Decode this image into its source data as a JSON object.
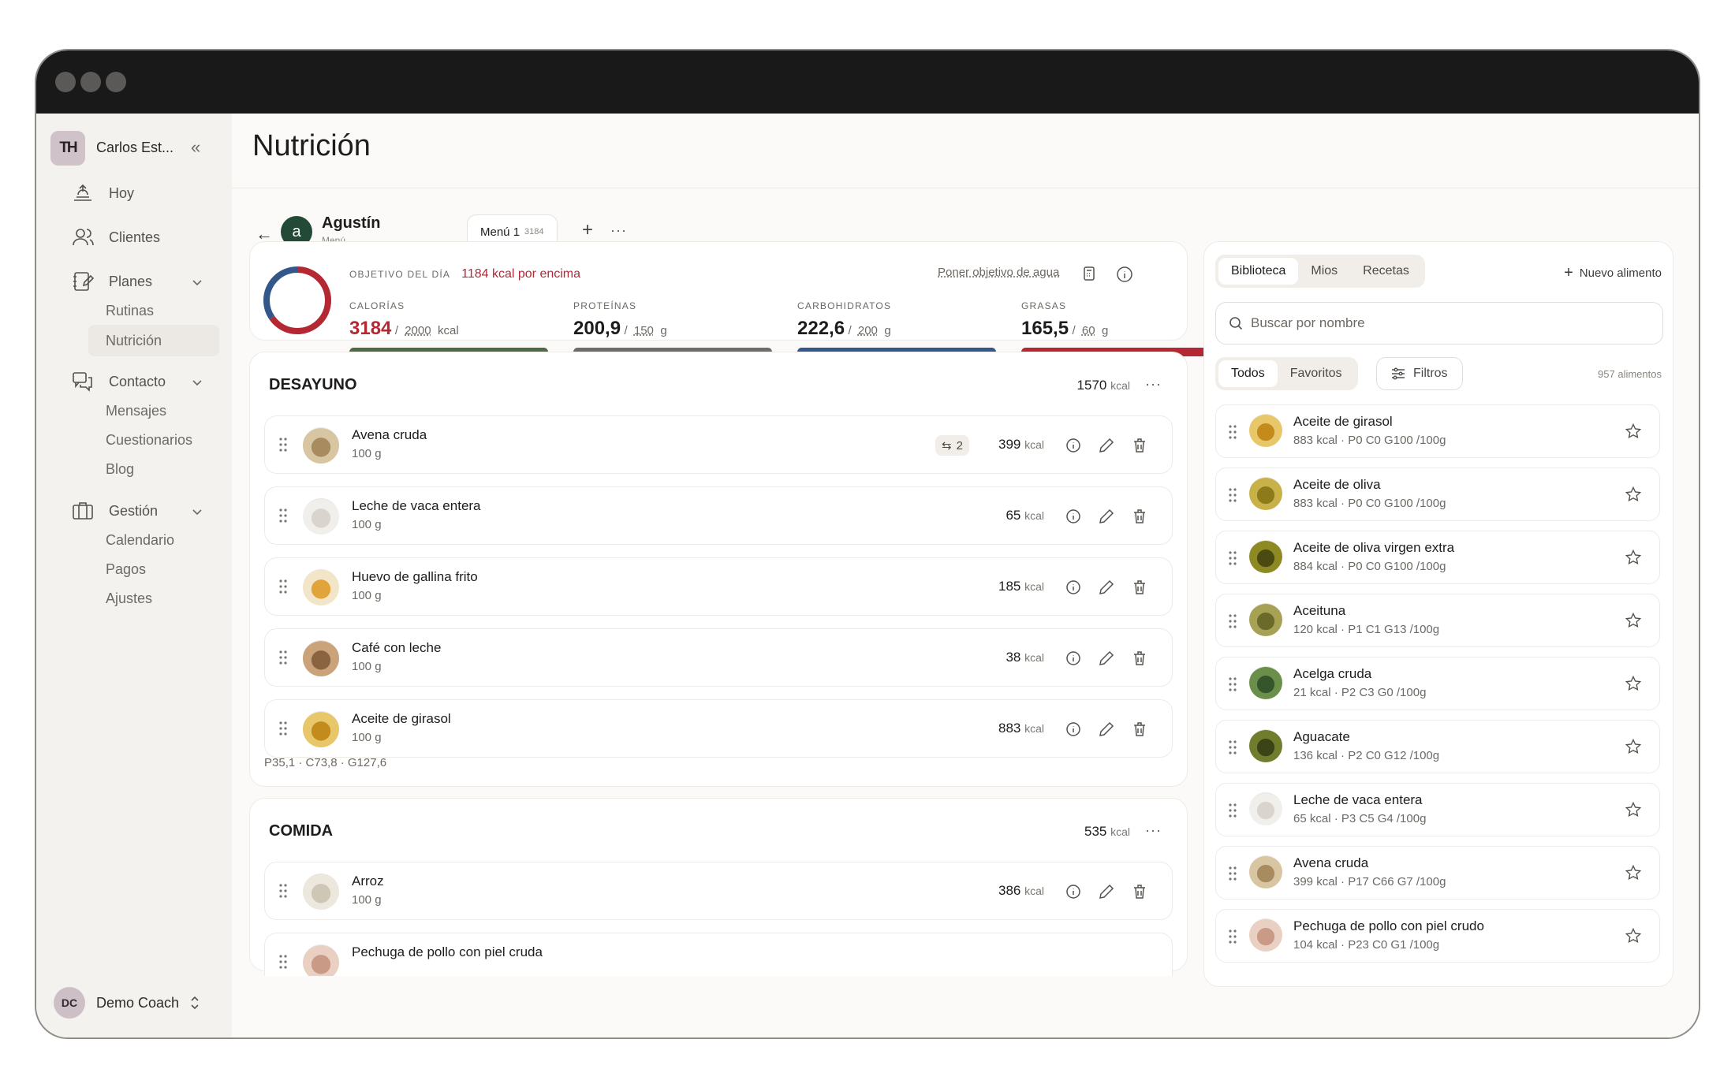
{
  "workspace": {
    "name": "Carlos Est...",
    "logo": "TH"
  },
  "nav": {
    "hoy": "Hoy",
    "clientes": "Clientes",
    "planes": "Planes",
    "rutinas": "Rutinas",
    "nutricion": "Nutrición",
    "contacto": "Contacto",
    "mensajes": "Mensajes",
    "cuestionarios": "Cuestionarios",
    "blog": "Blog",
    "gestion": "Gestión",
    "calendario": "Calendario",
    "pagos": "Pagos",
    "ajustes": "Ajustes"
  },
  "user": {
    "initials": "DC",
    "name": "Demo Coach"
  },
  "page": {
    "title": "Nutrición"
  },
  "client": {
    "initial": "a",
    "name": "Agustín",
    "sub": "Menú"
  },
  "menu": {
    "label": "Menú 1",
    "kcal": "3184"
  },
  "goal": {
    "label": "Objetivo del día",
    "status": "1184 kcal por encima",
    "water_link": "Poner objetivo de agua",
    "macros": [
      {
        "label": "Calorías",
        "value": "3184",
        "target": "2000",
        "unit": "kcal",
        "color": "#4e6a45",
        "fill": 1.0
      },
      {
        "label": "Proteínas",
        "value": "200,9",
        "target": "150",
        "unit": "g",
        "color": "#6e6a6d",
        "fill": 1.0
      },
      {
        "label": "Carbohidratos",
        "value": "222,6",
        "target": "200",
        "unit": "g",
        "color": "#33578a",
        "fill": 1.0
      },
      {
        "label": "Grasas",
        "value": "165,5",
        "target": "60",
        "unit": "g",
        "color": "#b42834",
        "fill": 1.0
      }
    ]
  },
  "meals": [
    {
      "title": "DESAYUNO",
      "kcal": "1570",
      "kcal_unit": "kcal",
      "summary": "P35,1 · C73,8 · G127,6",
      "items": [
        {
          "name": "Avena cruda",
          "qty": "100 g",
          "kcal": "399",
          "badge": "2"
        },
        {
          "name": "Leche de vaca entera",
          "qty": "100 g",
          "kcal": "65"
        },
        {
          "name": "Huevo de gallina frito",
          "qty": "100 g",
          "kcal": "185"
        },
        {
          "name": "Café con leche",
          "qty": "100 g",
          "kcal": "38"
        },
        {
          "name": "Aceite de girasol",
          "qty": "100 g",
          "kcal": "883"
        }
      ]
    },
    {
      "title": "COMIDA",
      "kcal": "535",
      "kcal_unit": "kcal",
      "items": [
        {
          "name": "Arroz",
          "qty": "100 g",
          "kcal": "386"
        },
        {
          "name": "Pechuga de pollo con piel cruda"
        }
      ]
    }
  ],
  "library": {
    "tabs": [
      "Biblioteca",
      "Mios",
      "Recetas"
    ],
    "new_food": "Nuevo alimento",
    "search_placeholder": "Buscar por nombre",
    "filters": [
      "Todos",
      "Favoritos"
    ],
    "filter_button": "Filtros",
    "count": "957 alimentos",
    "items": [
      {
        "name": "Aceite de girasol",
        "info": "883 kcal · P0 C0 G100 /100g"
      },
      {
        "name": "Aceite de oliva",
        "info": "883 kcal · P0 C0 G100 /100g"
      },
      {
        "name": "Aceite de oliva virgen extra",
        "info": "884 kcal · P0 C0 G100 /100g"
      },
      {
        "name": "Aceituna",
        "info": "120 kcal · P1 C1 G13 /100g"
      },
      {
        "name": "Acelga cruda",
        "info": "21 kcal · P2 C3 G0 /100g"
      },
      {
        "name": "Aguacate",
        "info": "136 kcal · P2 C0 G12 /100g"
      },
      {
        "name": "Leche de vaca entera",
        "info": "65 kcal · P3 C5 G4 /100g"
      },
      {
        "name": "Avena cruda",
        "info": "399 kcal · P17 C66 G7 /100g"
      },
      {
        "name": "Pechuga de pollo con piel crudo",
        "info": "104 kcal · P23 C0 G1 /100g"
      }
    ]
  }
}
